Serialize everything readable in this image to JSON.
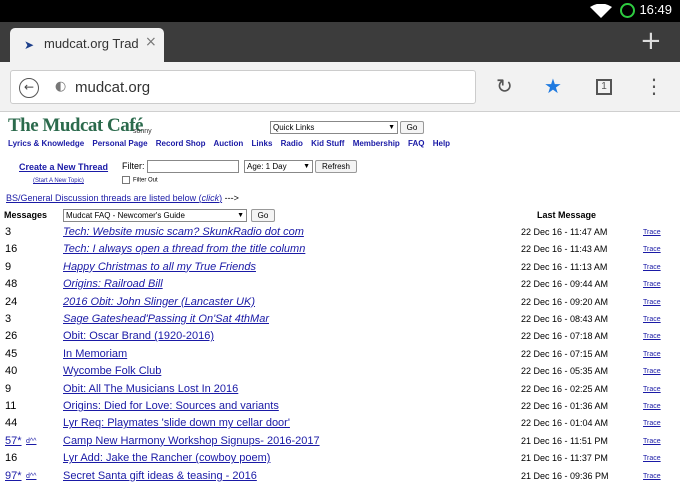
{
  "status_bar": {
    "time": "16:49"
  },
  "browser": {
    "tab_title": "mudcat.org Trad",
    "url": "mudcat.org",
    "tab_count": "1",
    "new_tab_glyph": "+",
    "close_glyph": "×",
    "back_glyph": "←",
    "reload_glyph": "↻",
    "bookmark_glyph": "★",
    "menu_glyph": "⋮"
  },
  "site": {
    "logo": "The Mudcat Café",
    "logo_user": "sonny",
    "quick_links": "Quick Links",
    "go": "Go",
    "nav": [
      "Lyrics & Knowledge",
      "Personal Page",
      "Record Shop",
      "Auction",
      "Links",
      "Radio",
      "Kid Stuff",
      "Membership",
      "FAQ",
      "Help"
    ],
    "create_thread": "Create a New Thread",
    "start_topic": "(Start A New Topic)",
    "filter_label": "Filter:",
    "age_select": "Age: 1 Day",
    "refresh": "Refresh",
    "filter_out": "Filter Out",
    "bs_prefix": "BS/General Discussion threads are listed below (",
    "bs_click": "click",
    "bs_suffix": ")",
    "bs_arrow": "--->",
    "col_messages": "Messages",
    "faq_select": "Mudcat FAQ - Newcomer's Guide",
    "col_last": "Last Message",
    "trace": "Trace"
  },
  "threads": [
    {
      "count": "3",
      "title": "Tech: Website music scam? SkunkRadio dot com",
      "date": "22 Dec 16 - 11:47 AM",
      "italic": true
    },
    {
      "count": "16",
      "title": "Tech: I always open a thread from the title column",
      "date": "22 Dec 16 - 11:43 AM",
      "italic": true
    },
    {
      "count": "9",
      "title": "Happy Christmas to all my True Friends",
      "date": "22 Dec 16 - 11:13 AM",
      "italic": true
    },
    {
      "count": "48",
      "title": "Origins: Railroad Bill",
      "date": "22 Dec 16 - 09:44 AM",
      "italic": true
    },
    {
      "count": "24",
      "title": "2016 Obit: John Slinger (Lancaster UK)",
      "date": "22 Dec 16 - 09:20 AM",
      "italic": true
    },
    {
      "count": "3",
      "title": "Sage Gateshead'Passing it On'Sat 4thMar",
      "date": "22 Dec 16 - 08:43 AM",
      "italic": true
    },
    {
      "count": "26",
      "title": "Obit: Oscar Brand (1920-2016)",
      "date": "22 Dec 16 - 07:18 AM",
      "italic": false
    },
    {
      "count": "45",
      "title": "In Memoriam",
      "date": "22 Dec 16 - 07:15 AM",
      "italic": false
    },
    {
      "count": "40",
      "title": "Wycombe Folk Club",
      "date": "22 Dec 16 - 05:35 AM",
      "italic": false
    },
    {
      "count": "9",
      "title": "Obit: All The Musicians Lost In 2016",
      "date": "22 Dec 16 - 02:25 AM",
      "italic": false
    },
    {
      "count": "11",
      "title": "Origins: Died for Love: Sources and variants",
      "date": "22 Dec 16 - 01:36 AM",
      "italic": false
    },
    {
      "count": "44",
      "title": "Lyr Req: Playmates 'slide down my cellar door'",
      "date": "22 Dec 16 - 01:04 AM",
      "italic": false
    },
    {
      "count": "57*",
      "hat": "d^^",
      "title": "Camp New Harmony Workshop Signups- 2016-2017",
      "date": "21 Dec 16 - 11:51 PM",
      "italic": false
    },
    {
      "count": "16",
      "title": "Lyr Add: Jake the Rancher (cowboy poem)",
      "date": "21 Dec 16 - 11:37 PM",
      "italic": false
    },
    {
      "count": "97*",
      "hat": "d^^",
      "title": "Secret Santa gift ideas & teasing - 2016",
      "date": "21 Dec 16 - 09:36 PM",
      "italic": false
    }
  ]
}
